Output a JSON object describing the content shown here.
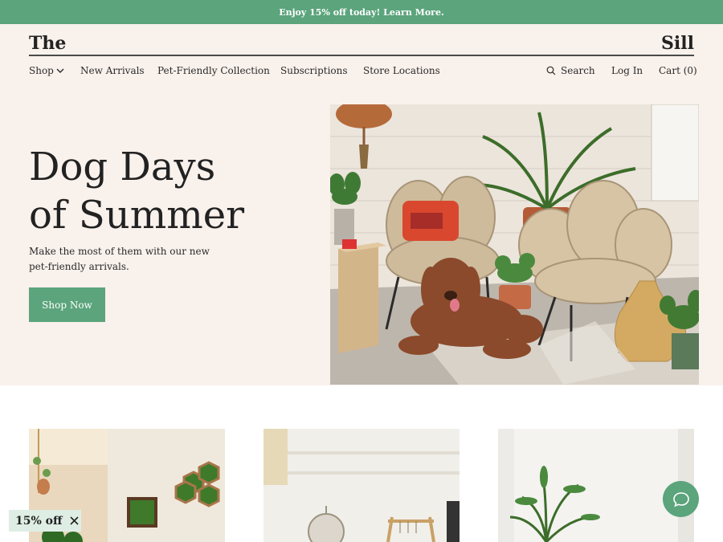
{
  "promo_bar": {
    "text": "Enjoy 15% off today! Learn More."
  },
  "header": {
    "logo_left": "The",
    "logo_right": "Sill",
    "nav": [
      {
        "label": "Shop",
        "icon": "chevron-down-icon"
      },
      {
        "label": "New Arrivals"
      },
      {
        "label": "Pet-Friendly Collection"
      },
      {
        "label": "Subscriptions"
      },
      {
        "label": "Store Locations"
      }
    ],
    "search_label": "Search",
    "login_label": "Log In",
    "cart_label": "Cart (0)"
  },
  "hero": {
    "title_line1": "Dog Days",
    "title_line2": "of Summer",
    "subtitle": "Make the most of them with our new pet-friendly arrivals.",
    "button_label": "Shop Now",
    "image": "dog-on-patio-with-wicker-chairs-and-plants"
  },
  "cards": [
    {
      "image": "moss-wall-frames"
    },
    {
      "image": "bright-room-with-mirror"
    },
    {
      "image": "palm-plant-white-wall"
    }
  ],
  "discount_badge": {
    "label": "15% off",
    "close_icon": "close-icon"
  },
  "chat": {
    "icon": "chat-bubble-icon"
  },
  "colors": {
    "accent": "#5ba47c",
    "cream": "#f9f1ec",
    "text": "#1f1f1f"
  }
}
